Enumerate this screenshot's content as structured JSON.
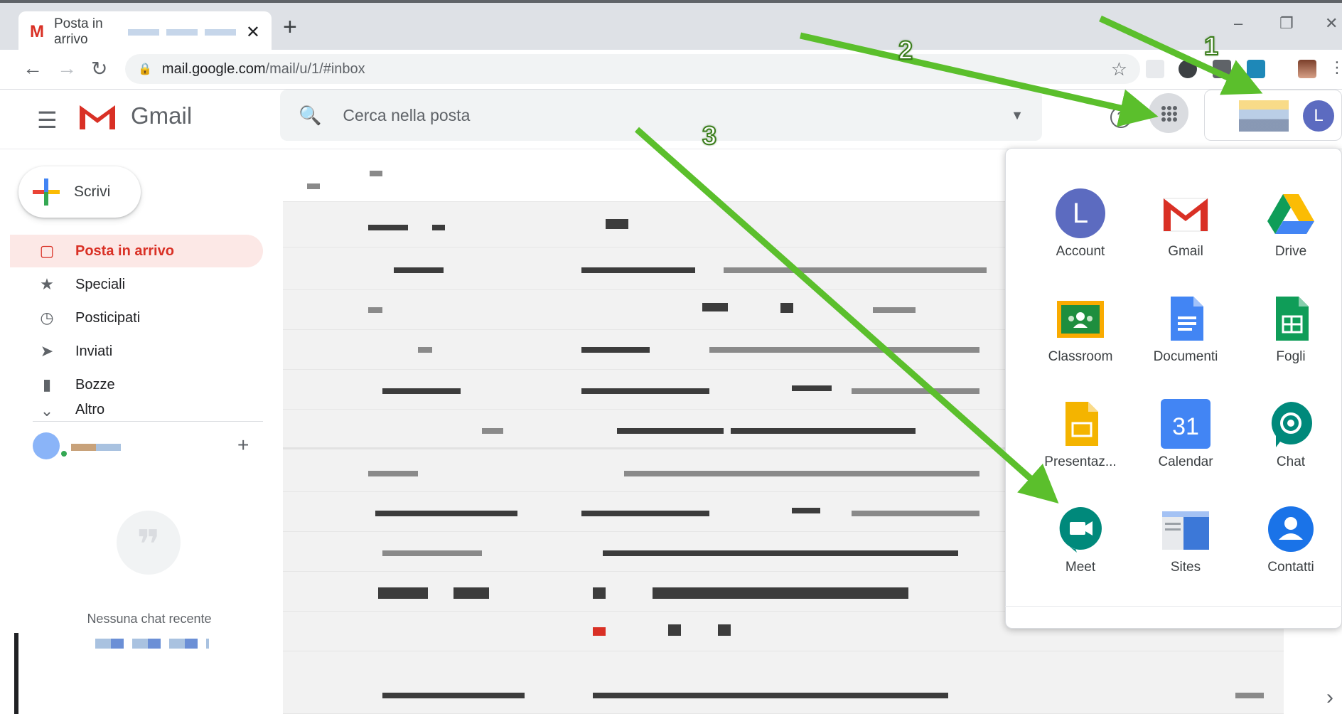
{
  "browser": {
    "tab_title": "Posta in arrivo",
    "tab_close": "✕",
    "new_tab": "+",
    "url_host": "mail.google.com",
    "url_path": "/mail/u/1/#inbox",
    "window_controls": [
      "–",
      "❐",
      "✕"
    ],
    "nav": {
      "back": "←",
      "forward": "→",
      "reload": "↻"
    }
  },
  "gmail": {
    "logo_text": "Gmail",
    "search_placeholder": "Cerca nella posta",
    "help_glyph": "?",
    "avatar_letter": "L",
    "compose_label": "Scrivi",
    "nav_items": [
      {
        "label": "Posta in arrivo",
        "icon": "inbox-icon",
        "glyph": "▢"
      },
      {
        "label": "Speciali",
        "icon": "star-icon",
        "glyph": "★"
      },
      {
        "label": "Posticipati",
        "icon": "clock-icon",
        "glyph": "◷"
      },
      {
        "label": "Inviati",
        "icon": "send-icon",
        "glyph": "➤"
      },
      {
        "label": "Bozze",
        "icon": "draft-icon",
        "glyph": "▮"
      },
      {
        "label": "Altro",
        "icon": "chevron-down-icon",
        "glyph": "⌄"
      }
    ],
    "chat_add": "+",
    "no_recent_chat": "Nessuna chat recente"
  },
  "apps_panel": {
    "apps": [
      {
        "label": "Account",
        "icon": "account-icon"
      },
      {
        "label": "Gmail",
        "icon": "gmail-icon"
      },
      {
        "label": "Drive",
        "icon": "drive-icon"
      },
      {
        "label": "Classroom",
        "icon": "classroom-icon"
      },
      {
        "label": "Documenti",
        "icon": "docs-icon"
      },
      {
        "label": "Fogli",
        "icon": "sheets-icon"
      },
      {
        "label": "Presentaz...",
        "icon": "slides-icon"
      },
      {
        "label": "Calendar",
        "icon": "calendar-icon"
      },
      {
        "label": "Chat",
        "icon": "chat-icon"
      },
      {
        "label": "Meet",
        "icon": "meet-icon"
      },
      {
        "label": "Sites",
        "icon": "sites-icon"
      },
      {
        "label": "Contatti",
        "icon": "contacts-icon"
      }
    ],
    "calendar_day": "31",
    "account_letter": "L"
  },
  "annotations": {
    "step1": "1",
    "step2": "2",
    "step3": "3",
    "arrow_color": "#5bbf2c"
  },
  "colors": {
    "gmail_red": "#d93025",
    "active_bg": "#fce8e6",
    "avatar": "#5c6bc0"
  },
  "scroll_right": "›"
}
